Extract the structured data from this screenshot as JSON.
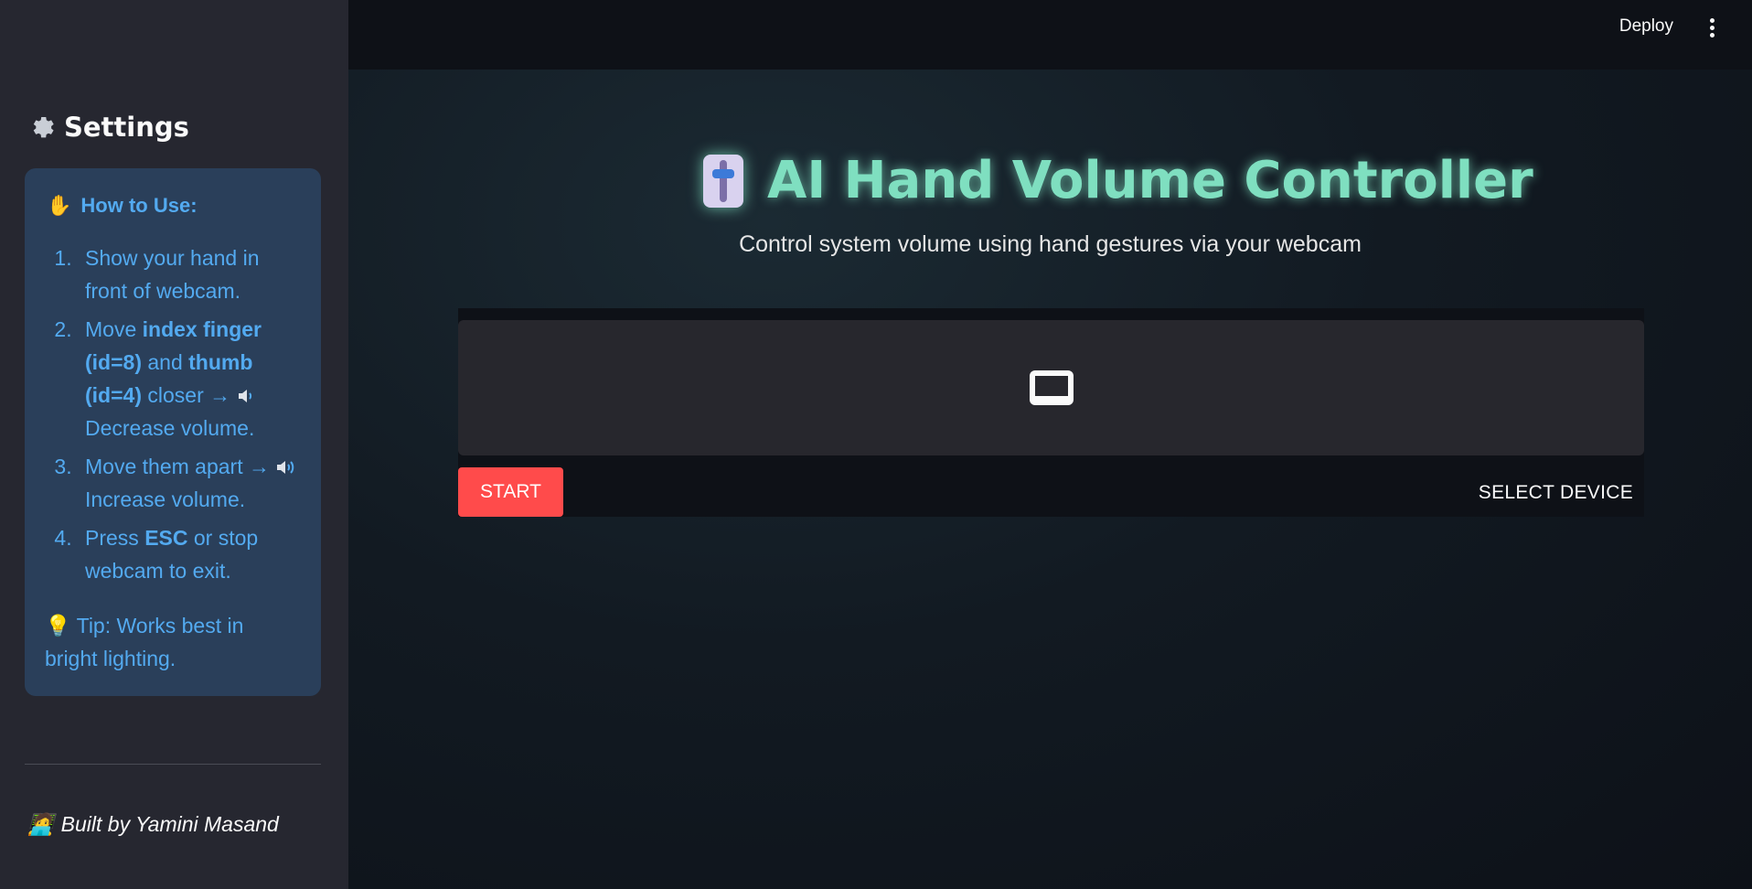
{
  "sidebar": {
    "title": "Settings",
    "title_icon": "gear-icon",
    "info": {
      "heading": "How to Use:",
      "heading_icon": "raised-hand-emoji",
      "steps": [
        {
          "text": "Show your hand in front of webcam."
        },
        {
          "pre": "Move ",
          "b1": "index finger (id=8)",
          "mid": " and ",
          "b2": "thumb (id=4)",
          "post": " closer →",
          "icon": "speaker-low-icon",
          "tail": "Decrease volume."
        },
        {
          "pre": "Move them apart →",
          "icon": "speaker-high-icon",
          "tail": "Increase volume."
        },
        {
          "pre": "Press ",
          "b1": "ESC",
          "post": " or stop webcam to exit."
        }
      ],
      "tip_icon": "lightbulb-emoji",
      "tip": "Tip: Works best in bright lighting."
    },
    "footer": "Built by Yamini Masand",
    "footer_icon": "technologist-emoji"
  },
  "header": {
    "deploy_label": "Deploy",
    "menu_icon": "vertical-dots-icon"
  },
  "main": {
    "title": "AI Hand Volume Controller",
    "title_icon": "level-slider-emoji",
    "subtitle": "Control system volume using hand gestures via your webcam",
    "webrtc": {
      "placeholder_icon": "monitor-icon",
      "start_label": "START",
      "select_device_label": "SELECT DEVICE"
    }
  },
  "colors": {
    "accent": "#ff4b4b",
    "title_glow": "#7fdfc0",
    "info_text": "#53aaf0",
    "info_bg": "#2a3f5a"
  }
}
